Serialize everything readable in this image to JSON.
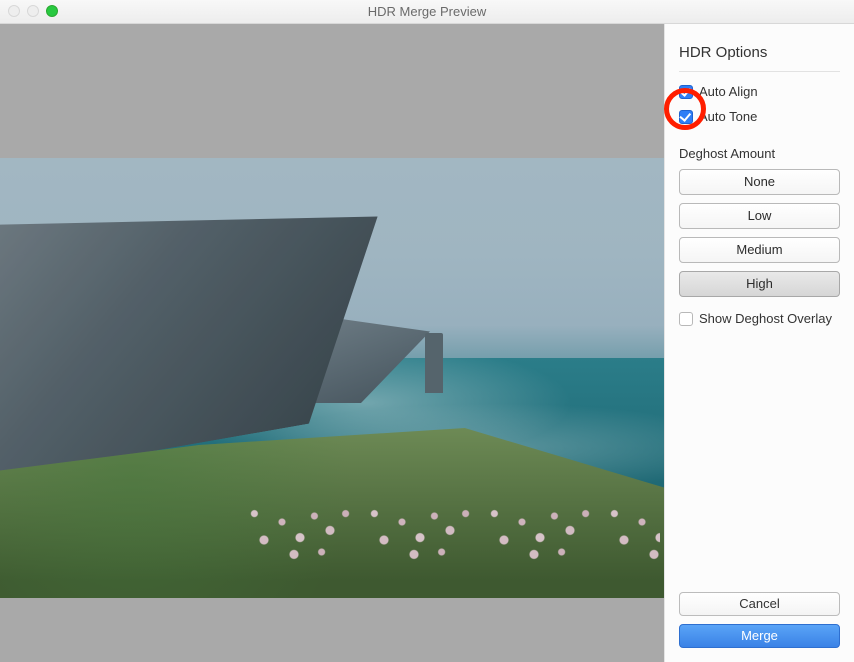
{
  "window": {
    "title": "HDR Merge Preview"
  },
  "panel": {
    "title": "HDR Options",
    "autoAlign": {
      "label": "Auto Align",
      "checked": true
    },
    "autoTone": {
      "label": "Auto Tone",
      "checked": true
    },
    "deghost": {
      "label": "Deghost Amount",
      "options": [
        "None",
        "Low",
        "Medium",
        "High"
      ],
      "selected": "High"
    },
    "showOverlay": {
      "label": "Show Deghost Overlay",
      "checked": false
    }
  },
  "footer": {
    "cancel": "Cancel",
    "merge": "Merge"
  }
}
